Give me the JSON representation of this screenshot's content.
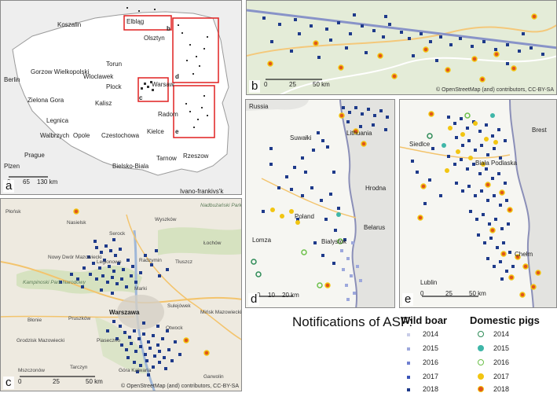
{
  "panels": {
    "a": {
      "letter": "a",
      "scale": {
        "zero": "0",
        "mid": "65",
        "end": "130 km"
      },
      "places": [
        "Koszalin",
        "Elbląg",
        "Olsztyn",
        "Torun",
        "Gorzow Wielkopolski",
        "Wloclawek",
        "Plock",
        "Warsaw",
        "Zielona Gora",
        "Kalisz",
        "Radom",
        "Legnica",
        "Kielce",
        "Walbrzych",
        "Opole",
        "Czestochowa",
        "Tarnow",
        "Rzeszow",
        "Bielsko-Biala",
        "Berlin",
        "Prague",
        "Plzen",
        "Ivano-frankivs'k"
      ],
      "inset_labels": [
        "b",
        "c",
        "d",
        "e"
      ]
    },
    "b": {
      "letter": "b",
      "scale": {
        "zero": "0",
        "mid": "25",
        "end": "50 km"
      },
      "credit": "© OpenStreetMap (and) contributors, CC-BY-SA"
    },
    "c": {
      "letter": "c",
      "scale": {
        "zero": "0",
        "mid": "25",
        "end": "50 km"
      },
      "credit": "© OpenStreetMap (and) contributors, CC-BY-SA",
      "places": [
        "Płońsk",
        "Nasielsk",
        "Serock",
        "Wyszków",
        "Łochów",
        "Nowy Dwór Mazowiecki",
        "Kampinoski Park Narodowy",
        "Legionowo",
        "Radzymin",
        "Tłuszcz",
        "Warszawa",
        "Pruszków",
        "Marki",
        "Sulejówek",
        "Grodzisk Mazowiecki",
        "Piaseczno",
        "Otwock",
        "Mińsk Mazowiecki",
        "Błonie",
        "Garwolin",
        "Mszczonów",
        "Tarczyn",
        "Góra Kalwaria",
        "Nadbużański Park Krajobrazowy"
      ]
    },
    "d": {
      "letter": "d",
      "scale": {
        "zero": "0",
        "mid1": "10",
        "mid2": "20 km"
      },
      "places": [
        "Russia",
        "Suwałki",
        "Lithuania",
        "Hrodna",
        "Poland",
        "Lomza",
        "Belarus",
        "Bialystok"
      ]
    },
    "e": {
      "letter": "e",
      "scale": {
        "zero": "0",
        "mid": "25",
        "end": "50 km"
      },
      "places": [
        "Siedlce",
        "Brest",
        "Biała Podlaska",
        "Lublin",
        "Chełm"
      ]
    }
  },
  "legend": {
    "title": "Notifications of ASF:",
    "wild_boar": {
      "title": "Wild boar",
      "years": [
        "2014",
        "2015",
        "2016",
        "2017",
        "2018"
      ],
      "colors": [
        "#c9cde8",
        "#9da8dc",
        "#6f7fd0",
        "#3a53b8",
        "#1e3a8a"
      ]
    },
    "domestic_pigs": {
      "title": "Domestic pigs",
      "years": [
        "2014",
        "2015",
        "2016",
        "2017",
        "2018"
      ],
      "colors": [
        "#2e8b57",
        "#3fb6a8",
        "#6cc04a",
        "#f2c511",
        "#e0561c"
      ]
    }
  }
}
